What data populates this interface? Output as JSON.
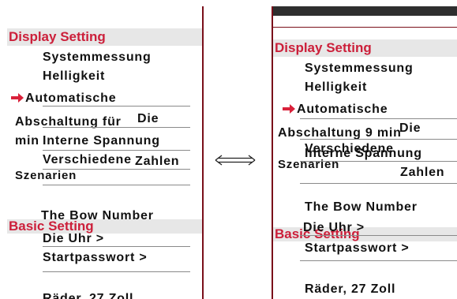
{
  "left_menu": {
    "display_section": "Display Setting",
    "items": {
      "systemmessung": "Systemmessung",
      "helligkeit": "Helligkeit",
      "automatische": "Automatische",
      "abschaltung": "Abschaltung für",
      "die": "Die",
      "min": "min",
      "interne_spannung": "Interne Spannung",
      "verschiedene": "Verschiedene",
      "zahlen": "Zahlen",
      "szenarien": "Szenarien",
      "bow_number": "The Bow Number",
      "uhr": "Die Uhr >",
      "startpasswort": "Startpasswort >",
      "raeder": "Räder, 27 Zoll"
    },
    "basic_section": "Basic Setting"
  },
  "right_menu": {
    "display_section": "Display Setting",
    "items": {
      "systemmessung": "Systemmessung",
      "helligkeit": "Helligkeit",
      "automatische": "Automatische",
      "abschaltung": "Abschaltung 9 min",
      "die": "Die",
      "verschiedene": "Verschiedene",
      "interne_spannung": "Interne Spannung",
      "szenarien": "Szenarien",
      "zahlen": "Zahlen",
      "bow_number": "The Bow Number",
      "uhr": "Die Uhr >",
      "startpasswort": "Startpasswort >",
      "raeder": "Räder, 27 Zoll"
    },
    "basic_section": "Basic Setting"
  },
  "colors": {
    "section_text": "#cc1f3a",
    "section_bg": "#e7e7e7",
    "border": "#7a0f1a",
    "arrow": "#d9213a",
    "header_bar": "#2e2e2e"
  },
  "icons": {
    "selection_arrow": "right-arrow-icon",
    "swap": "double-arrow-icon"
  }
}
